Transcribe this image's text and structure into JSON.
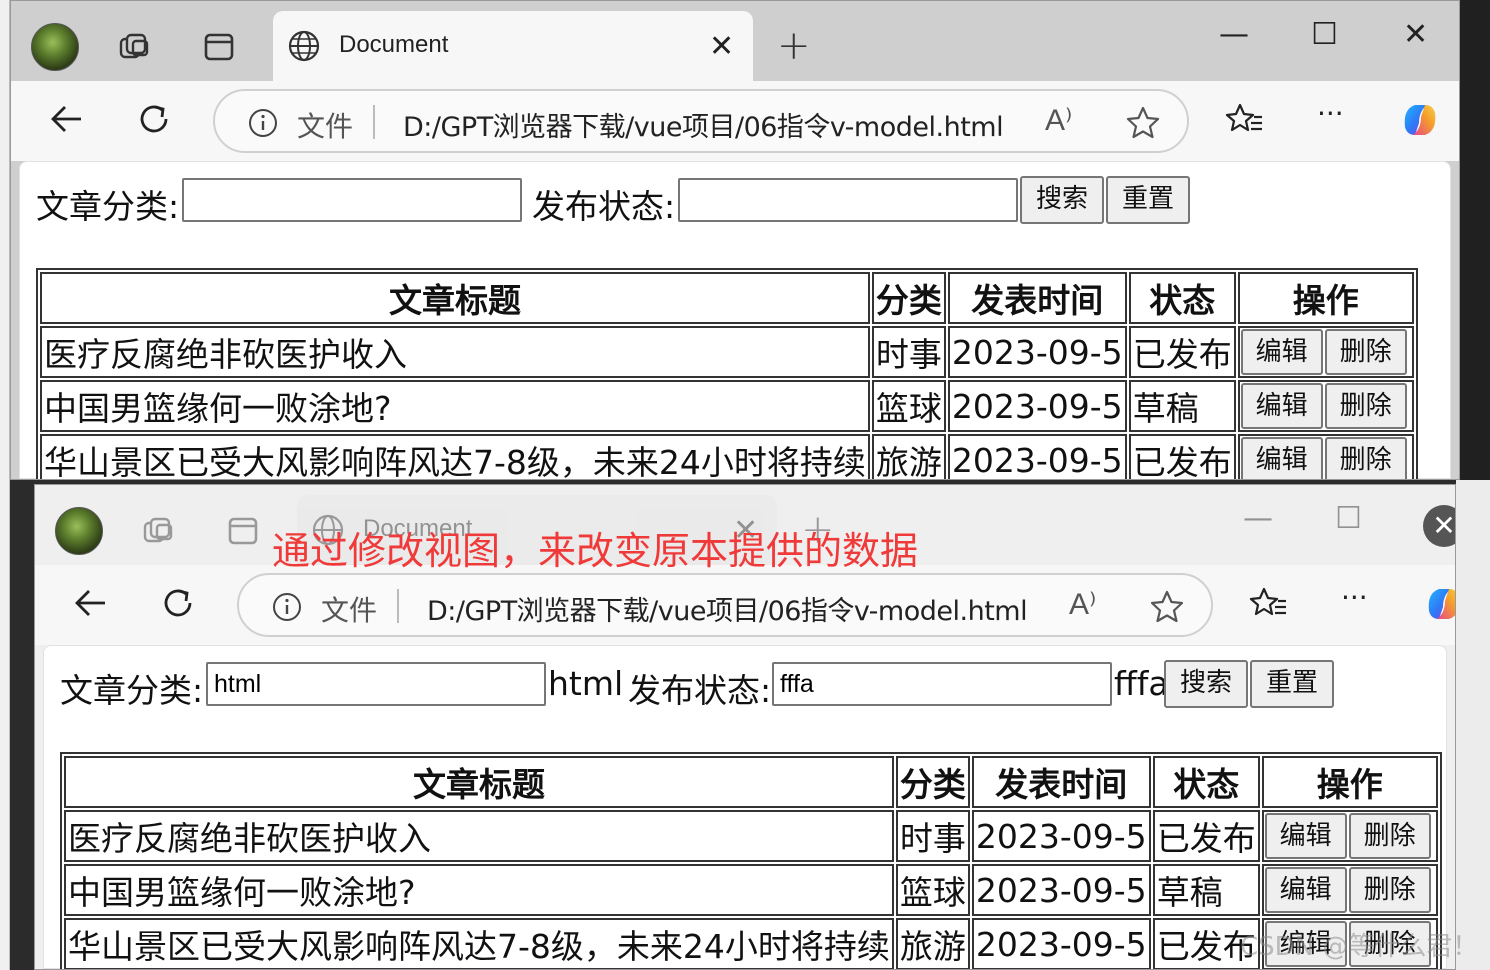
{
  "windows": [
    {
      "tab_title": "Document",
      "address": {
        "scheme_label": "文件",
        "url": "D:/GPT浏览器下载/vue项目/06指令v-model.html",
        "read_aloud": "A⁾"
      },
      "form": {
        "category_label": "文章分类:",
        "category_value": "",
        "category_echo": "",
        "status_label": "发布状态:",
        "status_value": "",
        "status_echo": "",
        "search_label": "搜索",
        "reset_label": "重置"
      }
    },
    {
      "tab_title": "Document",
      "address": {
        "scheme_label": "文件",
        "url": "D:/GPT浏览器下载/vue项目/06指令v-model.html",
        "read_aloud": "A⁾"
      },
      "form": {
        "category_label": "文章分类:",
        "category_value": "html",
        "category_echo": "html",
        "status_label": "发布状态:",
        "status_value": "fffa",
        "status_echo": "fffa",
        "search_label": "搜索",
        "reset_label": "重置"
      }
    }
  ],
  "table": {
    "headers": [
      "文章标题",
      "分类",
      "发表时间",
      "状态",
      "操作"
    ],
    "rows": [
      {
        "title": "医疗反腐绝非砍医护收入",
        "category": "时事",
        "time": "2023-09-5",
        "state": "已发布",
        "edit": "编辑",
        "delete": "删除"
      },
      {
        "title": "中国男篮缘何一败涂地?",
        "category": "篮球",
        "time": "2023-09-5",
        "state": "草稿",
        "edit": "编辑",
        "delete": "删除"
      },
      {
        "title": "华山景区已受大风影响阵风达7-8级，未来24小时将持续",
        "category": "旅游",
        "time": "2023-09-5",
        "state": "已发布",
        "edit": "编辑",
        "delete": "删除"
      }
    ]
  },
  "annotation": "通过修改视图，来改变原本提供的数据",
  "watermark": "CSDN @等什么君！",
  "icons": {
    "avatar": "forest-avatar",
    "workspaces": "workspaces-icon",
    "tab_actions": "vertical-tabs-icon",
    "globe": "globe-icon",
    "info": "info-icon",
    "favorites": "favorites-icon",
    "copilot": "copilot-icon"
  },
  "colors": {
    "annotation": "#f03a3a",
    "copilot_blue": "#2f7bf5",
    "copilot_pink": "#e8468e"
  }
}
